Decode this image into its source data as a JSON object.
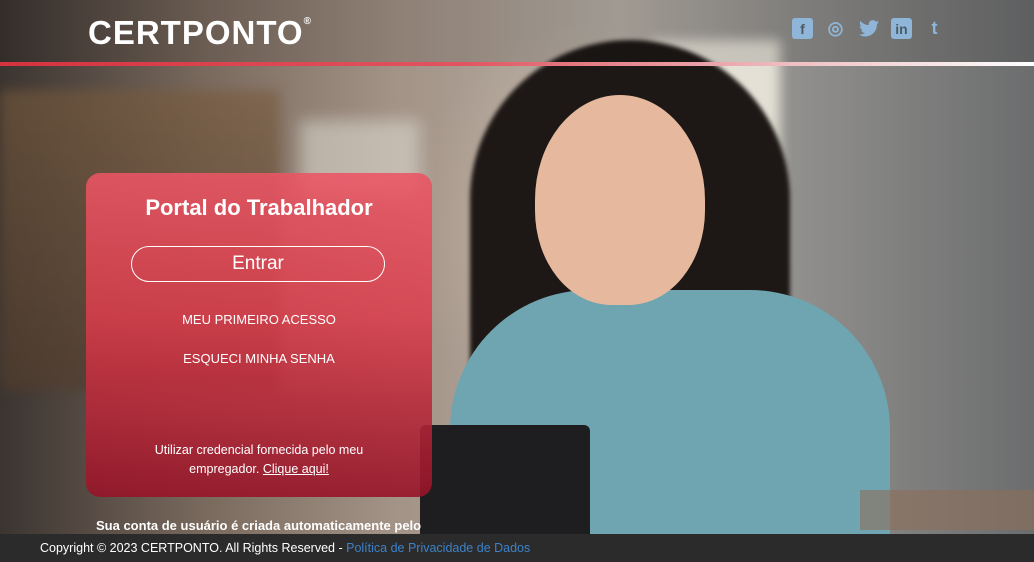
{
  "header": {
    "logo_text": "CERTPONTO",
    "logo_reg": "®",
    "social": [
      {
        "icon": "facebook-icon",
        "glyph": "f"
      },
      {
        "icon": "instagram-icon",
        "glyph": "◎"
      },
      {
        "icon": "twitter-icon",
        "glyph": "🐦"
      },
      {
        "icon": "linkedin-icon",
        "glyph": "in"
      },
      {
        "icon": "tumblr-icon",
        "glyph": "t"
      }
    ],
    "accent_color": "#d6323f",
    "social_color": "#8fb6d8"
  },
  "login_card": {
    "title": "Portal do Trabalhador",
    "enter_button": "Entrar",
    "first_access_link": "MEU PRIMEIRO ACESSO",
    "forgot_password_link": "ESQUECI MINHA SENHA",
    "info_text": "Utilizar credencial fornecida pelo meu empregador.",
    "info_link": "Clique aqui!"
  },
  "notice": "Sua conta de usuário é criada automaticamente pelo",
  "footer": {
    "copyright": "Copyright © 2023 CERTPONTO. All Rights Reserved -",
    "privacy_link": "Política de Privacidade de Dados"
  }
}
